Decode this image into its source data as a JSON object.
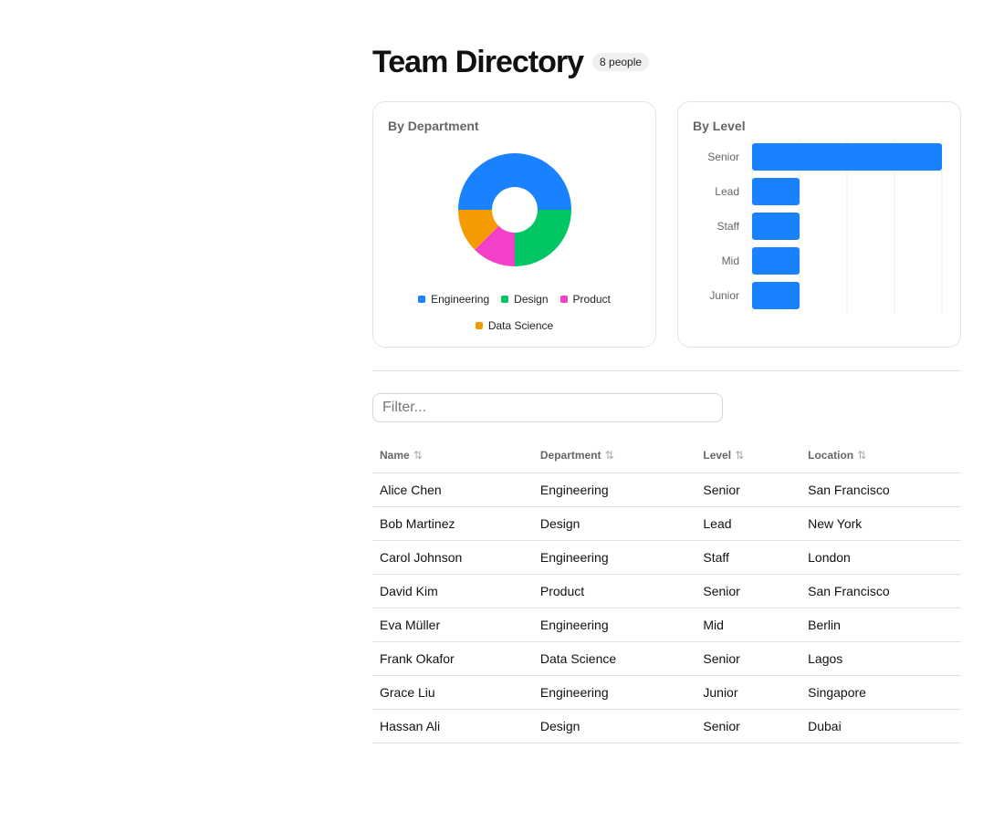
{
  "header": {
    "title": "Team Directory",
    "count_badge": "8 people"
  },
  "colors": {
    "engineering": "#1a82ff",
    "design": "#00c763",
    "product": "#f340c8",
    "data_science": "#f59a00",
    "bar": "#1a82ff"
  },
  "filter": {
    "placeholder": "Filter...",
    "value": ""
  },
  "table": {
    "columns": [
      {
        "label": "Name",
        "sort_icon": "sort-icon"
      },
      {
        "label": "Department",
        "sort_icon": "sort-icon"
      },
      {
        "label": "Level",
        "sort_icon": "sort-icon"
      },
      {
        "label": "Location",
        "sort_icon": "sort-icon"
      }
    ],
    "rows": [
      [
        "Alice Chen",
        "Engineering",
        "Senior",
        "San Francisco"
      ],
      [
        "Bob Martinez",
        "Design",
        "Lead",
        "New York"
      ],
      [
        "Carol Johnson",
        "Engineering",
        "Staff",
        "London"
      ],
      [
        "David Kim",
        "Product",
        "Senior",
        "San Francisco"
      ],
      [
        "Eva Müller",
        "Engineering",
        "Mid",
        "Berlin"
      ],
      [
        "Frank Okafor",
        "Data Science",
        "Senior",
        "Lagos"
      ],
      [
        "Grace Liu",
        "Engineering",
        "Junior",
        "Singapore"
      ],
      [
        "Hassan Ali",
        "Design",
        "Senior",
        "Dubai"
      ]
    ]
  },
  "chart_data": [
    {
      "type": "pie",
      "title": "By Department",
      "donut": true,
      "categories": [
        "Engineering",
        "Design",
        "Product",
        "Data Science"
      ],
      "values": [
        4,
        2,
        1,
        1
      ],
      "legend": "bottom"
    },
    {
      "type": "bar",
      "orientation": "horizontal",
      "title": "By Level",
      "categories": [
        "Senior",
        "Lead",
        "Staff",
        "Mid",
        "Junior"
      ],
      "values": [
        4,
        1,
        1,
        1,
        1
      ],
      "xlim": [
        0,
        4
      ],
      "grid": true
    }
  ]
}
